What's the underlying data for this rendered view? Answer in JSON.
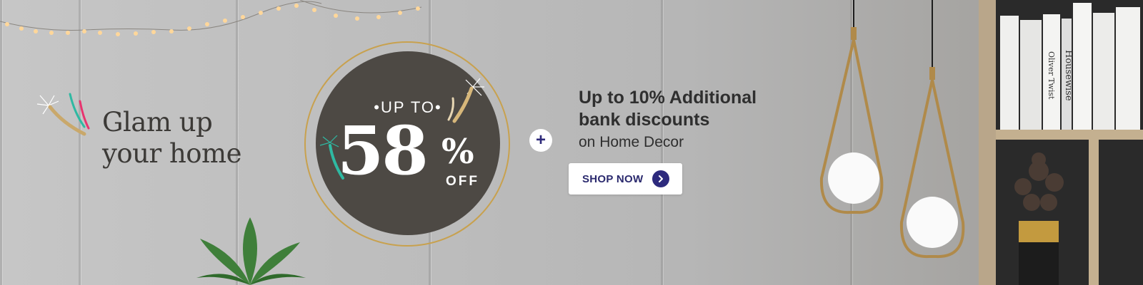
{
  "banner": {
    "headline": {
      "line1": "Glam up",
      "line2": "your home"
    },
    "offer": {
      "prefix": "•UP TO•",
      "percent": "58",
      "percent_sign": "%",
      "suffix": "OFF"
    },
    "plus_symbol": "+",
    "bank_offer": {
      "line1": "Up to 10% Additional",
      "line2": "bank discounts",
      "subtitle": "on Home Decor"
    },
    "cta": {
      "label": "SHOP NOW"
    },
    "book_spines": [
      "Oliver Twist",
      "Housewise"
    ]
  },
  "colors": {
    "background": "#bdbdbd",
    "offer_circle": "#4d4944",
    "gold_ring": "#c8a14e",
    "cta_text": "#2b2a6e",
    "cta_arrow": "#2d2a7d",
    "headline_text": "#3c3a37"
  },
  "icons": [
    "sparkle-icon",
    "chevron-right-icon",
    "plus-icon"
  ]
}
